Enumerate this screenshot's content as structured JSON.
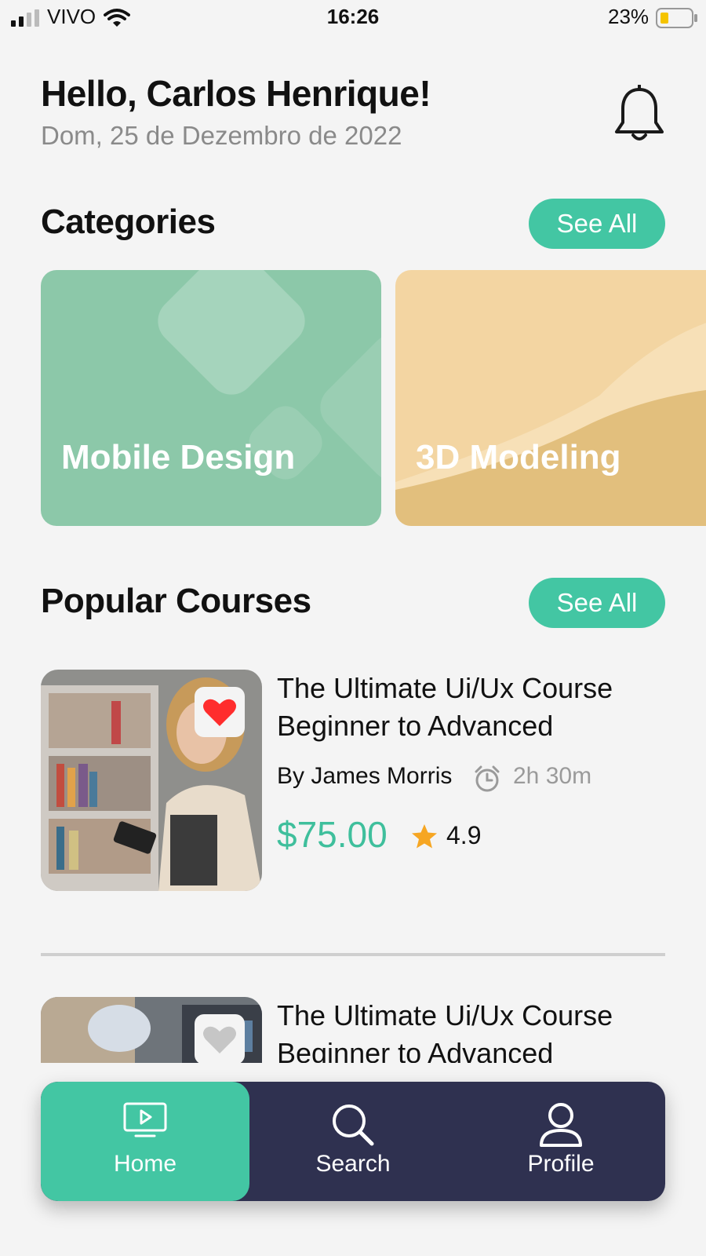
{
  "status_bar": {
    "carrier": "VIVO",
    "time": "16:26",
    "battery": "23%"
  },
  "header": {
    "greeting": "Hello, Carlos Henrique!",
    "date": "Dom, 25 de Dezembro de 2022"
  },
  "categories": {
    "title": "Categories",
    "see_all": "See All",
    "items": [
      {
        "label": "Mobile Design",
        "color": "#8cc8a9"
      },
      {
        "label": "3D Modeling",
        "color": "#f3d5a2"
      }
    ]
  },
  "popular": {
    "title": "Popular Courses",
    "see_all": "See All",
    "courses": [
      {
        "title": "The Ultimate Ui/Ux Course Beginner to Advanced",
        "author": "By James Morris",
        "duration": "2h 30m",
        "price": "$75.00",
        "rating": "4.9",
        "favorite": true
      },
      {
        "title": "The Ultimate Ui/Ux Course Beginner to Advanced",
        "favorite": false
      }
    ]
  },
  "nav": {
    "items": [
      {
        "label": "Home",
        "icon": "play-screen-icon",
        "active": true
      },
      {
        "label": "Search",
        "icon": "search-icon",
        "active": false
      },
      {
        "label": "Profile",
        "icon": "user-icon",
        "active": false
      }
    ]
  },
  "colors": {
    "accent": "#43c6a3",
    "nav_bg": "#2f3150",
    "favorite": "#ff2d2d",
    "star": "#f6a623"
  }
}
